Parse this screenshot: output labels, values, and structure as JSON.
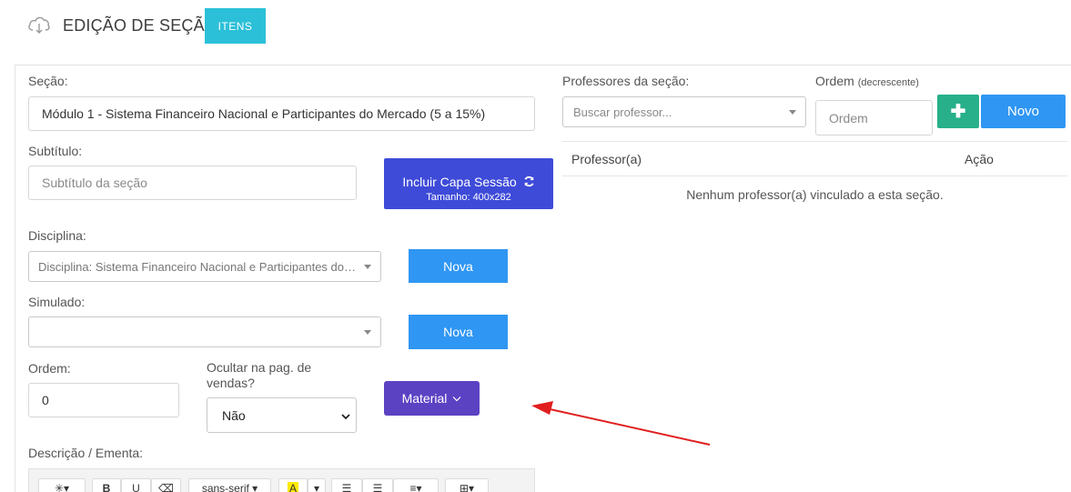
{
  "header": {
    "title": "EDIÇÃO DE SEÇÃO",
    "itens_label": "ITENS",
    "icon": "cloud-download-icon"
  },
  "form": {
    "secao_label": "Seção:",
    "secao_value": "Módulo 1 - Sistema Financeiro Nacional e Participantes do Mercado (5 a 15%)",
    "subtitulo_label": "Subtítulo:",
    "subtitulo_placeholder": "Subtítulo da seção",
    "capa_title": "Incluir Capa Sessão",
    "capa_size": "Tamanho: 400x282",
    "disciplina_label": "Disciplina:",
    "disciplina_value": "Disciplina: Sistema Financeiro Nacional e Participantes do…",
    "disciplina_btn": "Nova",
    "simulado_label": "Simulado:",
    "simulado_value": "",
    "simulado_btn": "Nova",
    "ordem_label": "Ordem:",
    "ordem_value": "0",
    "ocultar_label": "Ocultar na pag. de vendas?",
    "ocultar_value": "Não",
    "material_btn": "Material",
    "descricao_label": "Descrição / Ementa:"
  },
  "editor_toolbar": {
    "font_name": "sans-serif"
  },
  "professores": {
    "label": "Professores da seção:",
    "search_placeholder": "Buscar professor...",
    "ordem_label": "Ordem",
    "ordem_hint": "(decrescente)",
    "ordem_placeholder": "Ordem",
    "novo_btn": "Novo",
    "col_professor": "Professor(a)",
    "col_acao": "Ação",
    "empty": "Nenhum professor(a) vinculado a esta seção."
  },
  "colors": {
    "itens": "#2bc0d8",
    "capa": "#3e4bd8",
    "blue_btn": "#2f96f3",
    "material": "#5b42c3",
    "plus": "#27b08a",
    "arrow": "#e01e1e"
  }
}
